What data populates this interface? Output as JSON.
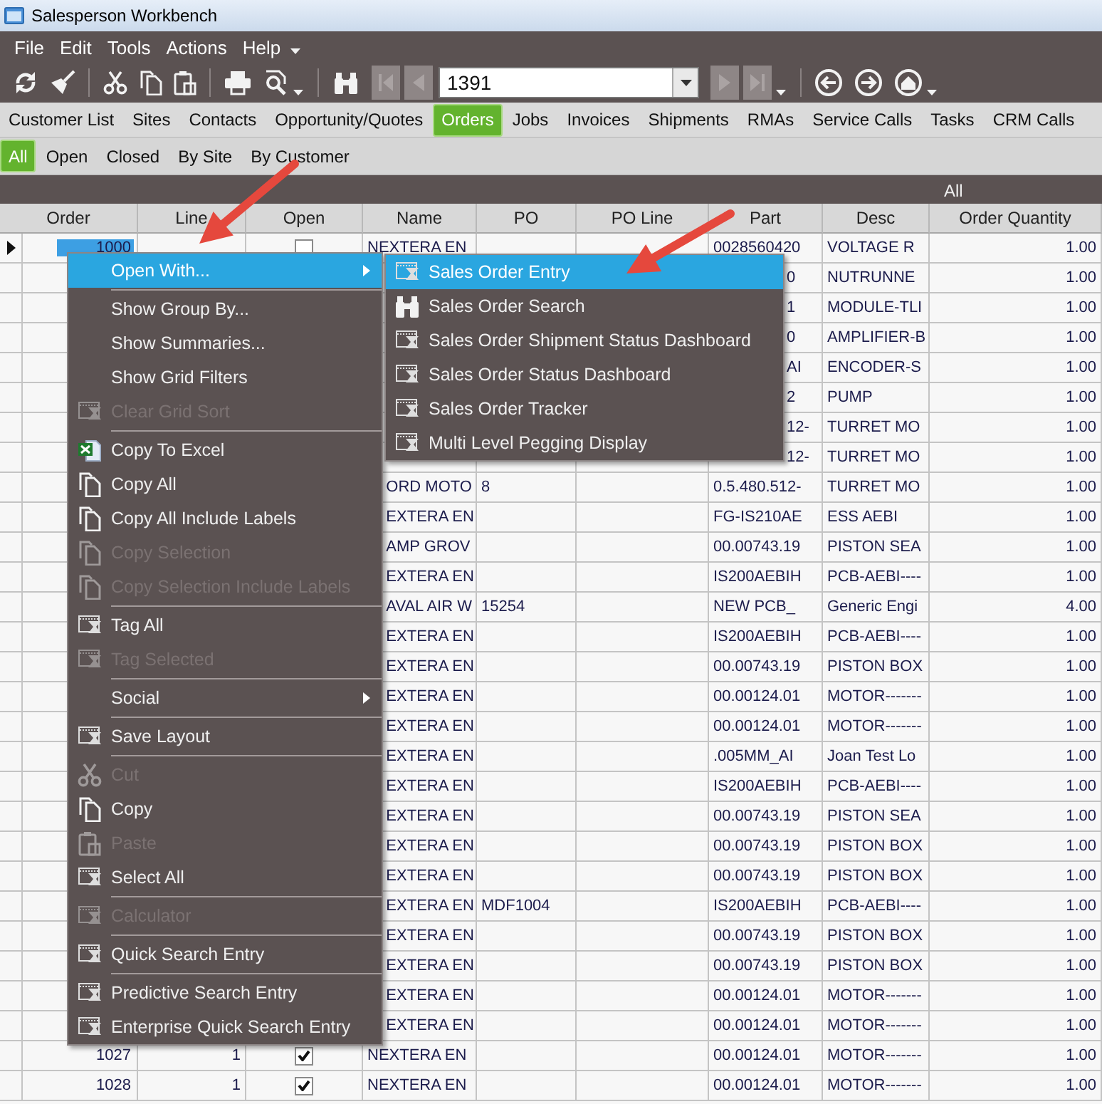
{
  "window": {
    "title": "Salesperson Workbench"
  },
  "menubar": {
    "items": [
      "File",
      "Edit",
      "Tools",
      "Actions",
      "Help"
    ]
  },
  "toolbar": {
    "record_field": {
      "value": "1391"
    }
  },
  "tabs": [
    {
      "label": "Customer List",
      "selected": false
    },
    {
      "label": "Sites",
      "selected": false
    },
    {
      "label": "Contacts",
      "selected": false
    },
    {
      "label": "Opportunity/Quotes",
      "selected": false
    },
    {
      "label": "Orders",
      "selected": true
    },
    {
      "label": "Jobs",
      "selected": false
    },
    {
      "label": "Invoices",
      "selected": false
    },
    {
      "label": "Shipments",
      "selected": false
    },
    {
      "label": "RMAs",
      "selected": false
    },
    {
      "label": "Service Calls",
      "selected": false
    },
    {
      "label": "Tasks",
      "selected": false
    },
    {
      "label": "CRM Calls",
      "selected": false
    }
  ],
  "filter_tabs": [
    {
      "label": "All",
      "selected": true
    },
    {
      "label": "Open",
      "selected": false
    },
    {
      "label": "Closed",
      "selected": false
    },
    {
      "label": "By Site",
      "selected": false
    },
    {
      "label": "By Customer",
      "selected": false
    }
  ],
  "grid": {
    "group_label": "All",
    "columns": [
      "Order",
      "Line",
      "Open",
      "Name",
      "PO",
      "PO Line",
      "Part",
      "Desc",
      "Order Quantity"
    ],
    "rows": [
      {
        "order": "1000",
        "open": false,
        "name": "NEXTERA EN",
        "part": "0028560420",
        "desc": "VOLTAGE R",
        "qty": "1.00",
        "selected": true
      },
      {
        "part": "0",
        "desc": "NUTRUNNE",
        "qty": "1.00",
        "selected": false
      },
      {
        "part": "1",
        "desc": "MODULE-TLI",
        "qty": "1.00",
        "selected": false
      },
      {
        "part": "0",
        "desc": "AMPLIFIER-B",
        "qty": "1.00",
        "selected": false
      },
      {
        "part": "AI",
        "desc": "ENCODER-S",
        "qty": "1.00",
        "selected": false
      },
      {
        "part": "2",
        "desc": "PUMP",
        "qty": "1.00",
        "selected": false
      },
      {
        "part": "12-",
        "desc": "TURRET MO",
        "qty": "1.00",
        "selected": false
      },
      {
        "part": "12-",
        "desc": "TURRET MO",
        "qty": "1.00",
        "selected": false
      },
      {
        "name": "ORD MOTO",
        "po": "8",
        "part": "0.5.480.512-",
        "desc": "TURRET MO",
        "qty": "1.00",
        "selected": false
      },
      {
        "name": "EXTERA EN",
        "part": "FG-IS210AE",
        "desc": "ESS AEBI",
        "qty": "1.00",
        "selected": false
      },
      {
        "name": "AMP GROV",
        "part": "00.00743.19",
        "desc": "PISTON SEA",
        "qty": "1.00",
        "selected": false
      },
      {
        "name": "EXTERA EN",
        "part": "IS200AEBIH",
        "desc": "PCB-AEBI----",
        "qty": "1.00",
        "selected": false
      },
      {
        "name": "AVAL AIR W",
        "po": "15254",
        "part": "NEW PCB_",
        "desc": "Generic Engi",
        "qty": "4.00",
        "selected": false
      },
      {
        "name": "EXTERA EN",
        "part": "IS200AEBIH",
        "desc": "PCB-AEBI----",
        "qty": "1.00",
        "selected": false
      },
      {
        "name": "EXTERA EN",
        "part": "00.00743.19",
        "desc": "PISTON BOX",
        "qty": "1.00",
        "selected": false
      },
      {
        "name": "EXTERA EN",
        "part": "00.00124.01",
        "desc": "MOTOR-------",
        "qty": "1.00",
        "selected": false
      },
      {
        "name": "EXTERA EN",
        "part": "00.00124.01",
        "desc": "MOTOR-------",
        "qty": "1.00",
        "selected": false
      },
      {
        "name": "EXTERA EN",
        "part": ".005MM_AI",
        "desc": "Joan Test Lo",
        "qty": "1.00",
        "selected": false
      },
      {
        "name": "EXTERA EN",
        "part": "IS200AEBIH",
        "desc": "PCB-AEBI----",
        "qty": "1.00",
        "selected": false
      },
      {
        "name": "EXTERA EN",
        "part": "00.00743.19",
        "desc": "PISTON SEA",
        "qty": "1.00",
        "selected": false
      },
      {
        "name": "EXTERA EN",
        "part": "00.00743.19",
        "desc": "PISTON BOX",
        "qty": "1.00",
        "selected": false
      },
      {
        "name": "EXTERA EN",
        "part": "00.00743.19",
        "desc": "PISTON BOX",
        "qty": "1.00",
        "selected": false
      },
      {
        "name": "EXTERA EN",
        "po": "MDF1004",
        "part": "IS200AEBIH",
        "desc": "PCB-AEBI----",
        "qty": "1.00",
        "selected": false
      },
      {
        "name": "EXTERA EN",
        "part": "00.00743.19",
        "desc": "PISTON BOX",
        "qty": "1.00",
        "selected": false
      },
      {
        "name": "EXTERA EN",
        "part": "00.00743.19",
        "desc": "PISTON BOX",
        "qty": "1.00",
        "selected": false
      },
      {
        "name": "EXTERA EN",
        "part": "00.00124.01",
        "desc": "MOTOR-------",
        "qty": "1.00",
        "selected": false
      },
      {
        "name": "EXTERA EN",
        "part": "00.00124.01",
        "desc": "MOTOR-------",
        "qty": "1.00",
        "selected": false
      },
      {
        "order": "1027",
        "line": "1",
        "open": true,
        "name": "NEXTERA EN",
        "part": "00.00124.01",
        "desc": "MOTOR-------",
        "qty": "1.00",
        "selected": false
      },
      {
        "order": "1028",
        "line": "1",
        "open": true,
        "name": "NEXTERA EN",
        "part": "00.00124.01",
        "desc": "MOTOR-------",
        "qty": "1.00",
        "selected": false
      }
    ]
  },
  "context_menu": {
    "groups": [
      [
        {
          "label": "Open With...",
          "kind": "plain",
          "submenu": true,
          "selected": true,
          "disabled": false
        }
      ],
      [
        {
          "label": "Show Group By...",
          "kind": "plain",
          "submenu": false,
          "selected": false,
          "disabled": false
        },
        {
          "label": "Show Summaries...",
          "kind": "plain",
          "submenu": false,
          "selected": false,
          "disabled": false
        },
        {
          "label": "Show Grid Filters",
          "kind": "plain",
          "submenu": false,
          "selected": false,
          "disabled": false
        },
        {
          "label": "Clear Grid Sort",
          "kind": "window",
          "submenu": false,
          "selected": false,
          "disabled": true
        }
      ],
      [
        {
          "label": "Copy To Excel",
          "kind": "excel",
          "submenu": false,
          "selected": false,
          "disabled": false
        },
        {
          "label": "Copy All",
          "kind": "copy",
          "submenu": false,
          "selected": false,
          "disabled": false
        },
        {
          "label": "Copy All Include Labels",
          "kind": "copy",
          "submenu": false,
          "selected": false,
          "disabled": false
        },
        {
          "label": "Copy Selection",
          "kind": "copy",
          "submenu": false,
          "selected": false,
          "disabled": true
        },
        {
          "label": "Copy Selection Include Labels",
          "kind": "copy",
          "submenu": false,
          "selected": false,
          "disabled": true
        }
      ],
      [
        {
          "label": "Tag All",
          "kind": "window",
          "submenu": false,
          "selected": false,
          "disabled": false
        },
        {
          "label": "Tag Selected",
          "kind": "window",
          "submenu": false,
          "selected": false,
          "disabled": true
        }
      ],
      [
        {
          "label": "Social",
          "kind": "plain",
          "submenu": true,
          "selected": false,
          "disabled": false
        }
      ],
      [
        {
          "label": "Save Layout",
          "kind": "window",
          "submenu": false,
          "selected": false,
          "disabled": false
        }
      ],
      [
        {
          "label": "Cut",
          "kind": "scissors",
          "submenu": false,
          "selected": false,
          "disabled": true
        },
        {
          "label": "Copy",
          "kind": "copy",
          "submenu": false,
          "selected": false,
          "disabled": false
        },
        {
          "label": "Paste",
          "kind": "clipboard",
          "submenu": false,
          "selected": false,
          "disabled": true
        },
        {
          "label": "Select All",
          "kind": "window",
          "submenu": false,
          "selected": false,
          "disabled": false
        }
      ],
      [
        {
          "label": "Calculator",
          "kind": "window",
          "submenu": false,
          "selected": false,
          "disabled": true
        }
      ],
      [
        {
          "label": "Quick Search Entry",
          "kind": "window",
          "submenu": false,
          "selected": false,
          "disabled": false
        }
      ],
      [
        {
          "label": "Predictive Search Entry",
          "kind": "window",
          "submenu": false,
          "selected": false,
          "disabled": false
        },
        {
          "label": "Enterprise Quick Search Entry",
          "kind": "window",
          "submenu": false,
          "selected": false,
          "disabled": false
        }
      ]
    ]
  },
  "submenu": {
    "groups": [
      [
        {
          "label": "Sales Order Entry",
          "kind": "window",
          "submenu": false,
          "selected": true,
          "disabled": false
        },
        {
          "label": "Sales Order Search",
          "kind": "binoculars",
          "submenu": false,
          "selected": false,
          "disabled": false
        },
        {
          "label": "Sales Order Shipment Status Dashboard",
          "kind": "window",
          "submenu": false,
          "selected": false,
          "disabled": false
        },
        {
          "label": "Sales Order Status Dashboard",
          "kind": "window",
          "submenu": false,
          "selected": false,
          "disabled": false
        },
        {
          "label": "Sales Order Tracker",
          "kind": "window",
          "submenu": false,
          "selected": false,
          "disabled": false
        },
        {
          "label": "Multi Level Pegging Display",
          "kind": "window",
          "submenu": false,
          "selected": false,
          "disabled": false
        }
      ]
    ]
  }
}
